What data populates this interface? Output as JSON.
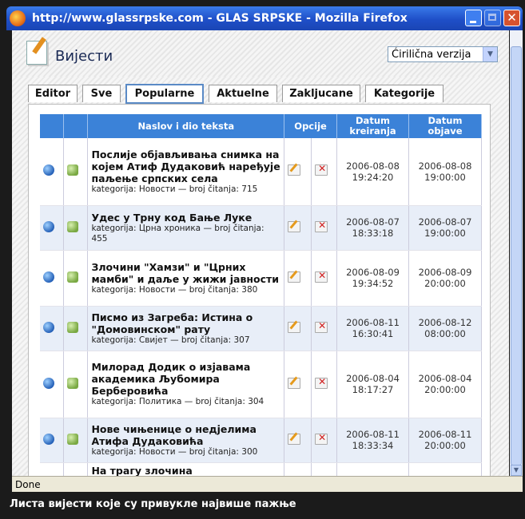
{
  "window": {
    "title": "http://www.glassrpske.com - GLAS SRPSKE - Mozilla Firefox",
    "close_glyph": "✕"
  },
  "app": {
    "title": "Вијести",
    "version_select": "Ćirilična verzija",
    "select_arrow": "▼"
  },
  "tabs": [
    {
      "label": "Editor"
    },
    {
      "label": "Sve"
    },
    {
      "label": "Popularne",
      "active": true
    },
    {
      "label": "Aktuelne"
    },
    {
      "label": "Zakljucane"
    },
    {
      "label": "Kategorije"
    }
  ],
  "table": {
    "headers": {
      "title": "Naslov i dio teksta",
      "options": "Opcije",
      "created": "Datum kreiranja",
      "published": "Datum objave"
    },
    "rows": [
      {
        "title": "Послије објављивања снимка на којем Атиф Дудаковић наређује паљење српских села",
        "meta": "kategorija: Новости — broj čitanja: 715",
        "created_date": "2006-08-08",
        "created_time": "19:24:20",
        "pub_date": "2006-08-08",
        "pub_time": "19:00:00"
      },
      {
        "title": "Удес у Трну код Бање Луке",
        "meta": "kategorija: Црна хроника — broj čitanja: 455",
        "created_date": "2006-08-07",
        "created_time": "18:33:18",
        "pub_date": "2006-08-07",
        "pub_time": "19:00:00"
      },
      {
        "title": "Злочини \"Хамзи\" и \"Црних мамби\" и даље у жижи јавности",
        "meta": "kategorija: Новости — broj čitanja: 380",
        "created_date": "2006-08-09",
        "created_time": "19:34:52",
        "pub_date": "2006-08-09",
        "pub_time": "20:00:00"
      },
      {
        "title": "Писмо из Загреба: Истина о \"Домовинском\" рату",
        "meta": "kategorija: Свијет — broj čitanja: 307",
        "created_date": "2006-08-11",
        "created_time": "16:30:41",
        "pub_date": "2006-08-12",
        "pub_time": "08:00:00"
      },
      {
        "title": "Милорад Додик о изјавама академика Љубомира Берберовића",
        "meta": "kategorija: Политика — broj čitanja: 304",
        "created_date": "2006-08-04",
        "created_time": "18:17:27",
        "pub_date": "2006-08-04",
        "pub_time": "20:00:00"
      },
      {
        "title": "Нове чињенице о недјелима Атифа Дудаковића",
        "meta": "kategorija: Новости — broj čitanja: 300",
        "created_date": "2006-08-11",
        "created_time": "18:33:34",
        "pub_date": "2006-08-11",
        "pub_time": "20:00:00"
      },
      {
        "title": "На трагу злочина",
        "meta": "",
        "created_date": "",
        "created_time": "",
        "pub_date": "",
        "pub_time": ""
      }
    ]
  },
  "scrollbar": {
    "down_glyph": "▼"
  },
  "status": {
    "text": "Done"
  },
  "caption": "Листа вијести које су привукле највише пажње"
}
